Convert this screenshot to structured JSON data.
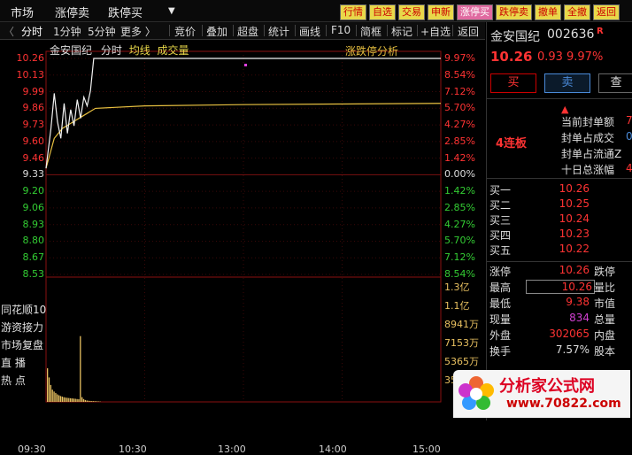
{
  "topbar": {
    "menu": [
      "市场",
      "涨停卖",
      "跌停买"
    ],
    "buttons": [
      "行情",
      "自选",
      "交易",
      "申新",
      "涨停买",
      "跌停卖",
      "撤单",
      "全撤",
      "返回"
    ]
  },
  "toolbar2": {
    "items": [
      "分时",
      "1分钟",
      "5分钟",
      "更多 〉",
      "竞价",
      "叠加",
      "超盘",
      "统计",
      "画线",
      "F10",
      "简框",
      "标记",
      "+自选",
      "返回"
    ]
  },
  "chart": {
    "stock_name": "金安国纪",
    "period": "分时",
    "avg_label": "均线",
    "vol_label": "成交量",
    "limit_analysis": "涨跌停分析",
    "price_ticks": [
      "10.26",
      "10.13",
      "9.99",
      "9.86",
      "9.73",
      "9.60",
      "9.46",
      "9.33",
      "9.20",
      "9.06",
      "8.93",
      "8.80",
      "8.67",
      "8.53"
    ],
    "pct_ticks": [
      "9.97%",
      "8.54%",
      "7.12%",
      "5.70%",
      "4.27%",
      "2.85%",
      "1.42%",
      "0.00%",
      "1.42%",
      "2.85%",
      "4.27%",
      "5.70%",
      "7.12%",
      "8.54%"
    ],
    "vol_ticks": [
      "1.3亿",
      "1.1亿",
      "8941万",
      "7153万",
      "5365万",
      "3576万"
    ],
    "left_items": [
      "同花顺10",
      "游资接力",
      "市场复盘",
      "直  播",
      "热  点"
    ],
    "times": [
      "09:30",
      "10:30",
      "13:00",
      "14:00",
      "15:00"
    ],
    "price_points": [
      [
        0,
        9.38
      ],
      [
        3,
        9.7
      ],
      [
        5,
        9.98
      ],
      [
        7,
        9.75
      ],
      [
        9,
        9.62
      ],
      [
        11,
        9.9
      ],
      [
        13,
        9.66
      ],
      [
        15,
        9.85
      ],
      [
        17,
        9.72
      ],
      [
        19,
        9.93
      ],
      [
        21,
        9.78
      ],
      [
        23,
        9.95
      ],
      [
        25,
        9.88
      ],
      [
        27,
        10.0
      ],
      [
        29,
        10.26
      ],
      [
        240,
        10.26
      ]
    ],
    "avg_points": [
      [
        0,
        9.38
      ],
      [
        5,
        9.62
      ],
      [
        10,
        9.7
      ],
      [
        15,
        9.74
      ],
      [
        20,
        9.78
      ],
      [
        25,
        9.82
      ],
      [
        30,
        9.86
      ],
      [
        60,
        9.88
      ],
      [
        120,
        9.89
      ],
      [
        180,
        9.895
      ],
      [
        240,
        9.9
      ]
    ],
    "volumes": [
      3576,
      2600,
      1800,
      1300,
      1100,
      950,
      800,
      700,
      620,
      560,
      500,
      460,
      430,
      410,
      390,
      370,
      350,
      330,
      300,
      280,
      7000,
      500,
      300,
      200,
      150,
      120,
      100,
      90,
      80,
      70,
      60,
      50,
      40
    ]
  },
  "quote": {
    "name": "金安国纪",
    "code": "002636",
    "badge": "R",
    "price": "10.26",
    "change": "0.93",
    "pct": "9.97%",
    "buy_btn": "买",
    "sell_btn": "卖",
    "query_btn": "查",
    "streak": "4连板",
    "info_items": [
      "当前封单额",
      "封单占成交",
      "封单占流通Z",
      "十日总涨幅"
    ],
    "info_vals": [
      "7",
      "0.",
      "",
      "4"
    ],
    "bids": [
      {
        "label": "买一",
        "price": "10.26"
      },
      {
        "label": "买二",
        "price": "10.25"
      },
      {
        "label": "买三",
        "price": "10.24"
      },
      {
        "label": "买四",
        "price": "10.23"
      },
      {
        "label": "买五",
        "price": "10.22"
      }
    ],
    "stats": [
      {
        "l1": "涨停",
        "v1": "10.26",
        "l2": "跌停"
      },
      {
        "l1": "最高",
        "v1": "10.26",
        "l2": "量比"
      },
      {
        "l1": "最低",
        "v1": "9.38",
        "l2": "市值"
      },
      {
        "l1": "现量",
        "v1": "834",
        "l2": "总量"
      },
      {
        "l1": "外盘",
        "v1": "302065",
        "l2": "内盘"
      },
      {
        "l1": "换手",
        "v1": "7.57%",
        "l2": "股本"
      }
    ]
  },
  "watermark": {
    "logo_text": "分析家公式网",
    "url": "www.70822.com"
  }
}
